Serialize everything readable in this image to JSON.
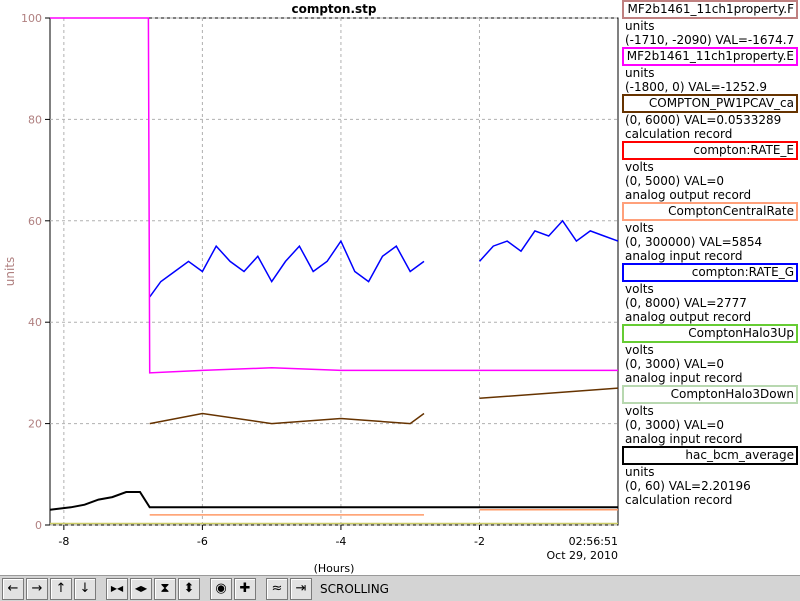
{
  "chart_data": {
    "type": "line",
    "title": "compton.stp",
    "xlabel": "(Hours)",
    "ylabel": "units",
    "xlim": [
      -8.2,
      0
    ],
    "ylim": [
      0,
      100
    ],
    "x_ticks": [
      -8,
      -6,
      -4,
      -2
    ],
    "x_tick_labels": [
      "-8",
      "-6",
      "-4",
      "-2"
    ],
    "y_ticks": [
      0,
      20,
      40,
      60,
      80,
      100
    ],
    "y_tick_labels": [
      "0",
      "20",
      "40",
      "60",
      "80",
      "100"
    ],
    "time_label": "02:56:51",
    "date_label": "Oct 29, 2010",
    "grid": true,
    "series": [
      {
        "name": "compton:RATE_G",
        "color": "#0000ff",
        "segments": [
          {
            "x": [
              -6.76,
              -6.6,
              -6.4,
              -6.2,
              -6.0,
              -5.8,
              -5.6,
              -5.4,
              -5.2,
              -5.0,
              -4.8,
              -4.6,
              -4.4,
              -4.2,
              -4.0,
              -3.8,
              -3.6,
              -3.4,
              -3.2,
              -3.0,
              -2.8
            ],
            "y": [
              45,
              48,
              50,
              52,
              50,
              55,
              52,
              50,
              53,
              48,
              52,
              55,
              50,
              52,
              56,
              50,
              48,
              53,
              55,
              50,
              52
            ]
          },
          {
            "x": [
              -2.0,
              -1.8,
              -1.6,
              -1.4,
              -1.2,
              -1.0,
              -0.8,
              -0.6,
              -0.4,
              -0.2,
              0.0
            ],
            "y": [
              52,
              55,
              56,
              54,
              58,
              57,
              60,
              56,
              58,
              57,
              56
            ]
          }
        ]
      },
      {
        "name": "MF2b1461_11ch1property.E",
        "color": "#ff00ff",
        "x": [
          -8.2,
          -6.78,
          -6.76,
          -6.0,
          -5.0,
          -4.0,
          -3.0,
          -2.0,
          -1.0,
          0.0
        ],
        "y": [
          100,
          100,
          30,
          30.5,
          31,
          30.5,
          30.5,
          30.5,
          30.5,
          30.5
        ]
      },
      {
        "name": "COMPTON_PW1PCAV_ca",
        "color": "#663300",
        "segments": [
          {
            "x": [
              -6.76,
              -6.0,
              -5.0,
              -4.0,
              -3.0,
              -2.8
            ],
            "y": [
              20,
              22,
              20,
              21,
              20,
              22
            ]
          },
          {
            "x": [
              -2.0,
              -1.0,
              0.0
            ],
            "y": [
              25,
              26,
              27
            ]
          }
        ]
      },
      {
        "name": "ComptonCentralRate",
        "color": "#ff9966",
        "segments": [
          {
            "x": [
              -6.76,
              -6.0,
              -5.0,
              -4.0,
              -3.0,
              -2.8
            ],
            "y": [
              2,
              2,
              2,
              2,
              2,
              2
            ]
          },
          {
            "x": [
              -2.0,
              -1.0,
              0.0
            ],
            "y": [
              3,
              3,
              3
            ]
          }
        ]
      },
      {
        "name": "hac_bcm_average",
        "color": "#000000",
        "x": [
          -8.2,
          -7.9,
          -7.7,
          -7.5,
          -7.3,
          -7.1,
          -6.9,
          -6.76,
          -2.8,
          0.0
        ],
        "y": [
          3,
          3.5,
          4,
          5,
          5.5,
          6.5,
          6.5,
          3.5,
          3.5,
          3.5
        ]
      },
      {
        "name": "compton:RATE_E",
        "color": "#cccc66",
        "x": [
          -8.2,
          0.0
        ],
        "y": [
          0.3,
          0.3
        ]
      }
    ]
  },
  "legend": [
    {
      "name": "MF2b1461_11ch1property.F",
      "color": "#bf8080",
      "lines": [
        "units",
        "(-1710, -2090) VAL=-1674.7"
      ]
    },
    {
      "name": "MF2b1461_11ch1property.E",
      "color": "#ff00ff",
      "lines": [
        "units",
        "(-1800, 0) VAL=-1252.9"
      ]
    },
    {
      "name": "COMPTON_PW1PCAV_ca",
      "color": "#663300",
      "lines": [
        "(0, 6000) VAL=0.0533289",
        "calculation record"
      ]
    },
    {
      "name": "compton:RATE_E",
      "color": "#ff0000",
      "lines": [
        "volts",
        "(0, 5000)  VAL=0",
        "analog output record"
      ]
    },
    {
      "name": "ComptonCentralRate",
      "color": "#ffa07a",
      "lines": [
        "volts",
        "(0, 300000) VAL=5854",
        "analog input record"
      ]
    },
    {
      "name": "compton:RATE_G",
      "color": "#0000ff",
      "lines": [
        "volts",
        "(0, 8000) VAL=2777",
        "analog output record"
      ]
    },
    {
      "name": "ComptonHalo3Up",
      "color": "#66cc33",
      "lines": [
        "volts",
        "(0, 3000)  VAL=0",
        "analog input record"
      ]
    },
    {
      "name": "ComptonHalo3Down",
      "color": "#b8d8b0",
      "lines": [
        "volts",
        "(0, 3000)  VAL=0",
        "analog input record"
      ]
    },
    {
      "name": "hac_bcm_average",
      "color": "#000000",
      "lines": [
        "units",
        "(0, 60) VAL=2.20196",
        "calculation record"
      ]
    }
  ],
  "toolbar": {
    "buttons": [
      {
        "icon": "arrow-left-icon",
        "glyph": "←"
      },
      {
        "icon": "arrow-right-icon",
        "glyph": "→"
      },
      {
        "icon": "arrow-up-icon",
        "glyph": "↑"
      },
      {
        "icon": "arrow-down-icon",
        "glyph": "↓"
      },
      {
        "icon": "zoom-in-horizontal-icon",
        "glyph": "▶◀"
      },
      {
        "icon": "zoom-out-horizontal-icon",
        "glyph": "◀▶"
      },
      {
        "icon": "zoom-in-vertical-icon",
        "glyph": "⧗"
      },
      {
        "icon": "zoom-out-vertical-icon",
        "glyph": "⬍"
      },
      {
        "icon": "reset-icon",
        "glyph": "◉"
      },
      {
        "icon": "crosshair-icon",
        "glyph": "✚"
      },
      {
        "icon": "plot-style-icon",
        "glyph": "≈"
      },
      {
        "icon": "scroll-mode-icon",
        "glyph": "⇥"
      }
    ],
    "status": "SCROLLING"
  }
}
